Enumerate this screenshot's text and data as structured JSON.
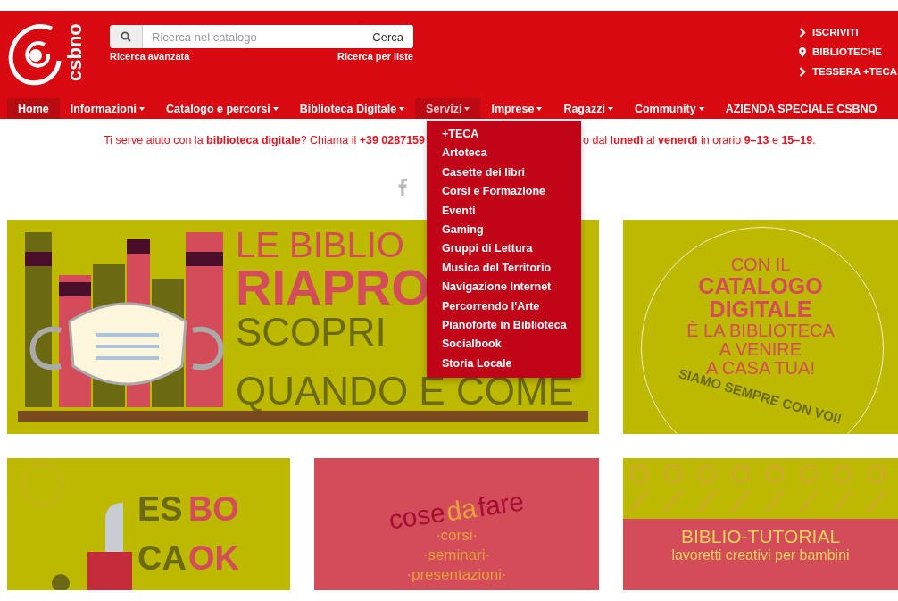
{
  "logo": {
    "text": "csbno"
  },
  "search": {
    "placeholder": "Ricerca nel catalogo",
    "button": "Cerca",
    "links": [
      "Ricerca avanzata",
      "Ricerca per liste"
    ]
  },
  "top_links": [
    {
      "label": "ISCRIVITI"
    },
    {
      "label": "BIBLIOTECHE"
    },
    {
      "label": "TESSERA +TECA"
    }
  ],
  "nav": [
    {
      "label": "Home",
      "selected": true,
      "has_menu": false,
      "expanded": false
    },
    {
      "label": "Informazioni",
      "selected": false,
      "has_menu": true,
      "expanded": false
    },
    {
      "label": "Catalogo e percorsi",
      "selected": false,
      "has_menu": true,
      "expanded": false
    },
    {
      "label": "Biblioteca Digitale",
      "selected": false,
      "has_menu": true,
      "expanded": false
    },
    {
      "label": "Servizi",
      "selected": false,
      "has_menu": true,
      "expanded": true
    },
    {
      "label": "Imprese",
      "selected": false,
      "has_menu": true,
      "expanded": false
    },
    {
      "label": "Ragazzi",
      "selected": false,
      "has_menu": true,
      "expanded": false
    },
    {
      "label": "Community",
      "selected": false,
      "has_menu": true,
      "expanded": false
    },
    {
      "label": "AZIENDA SPECIALE CSBNO",
      "selected": false,
      "has_menu": false,
      "expanded": false
    }
  ],
  "services_menu": {
    "items": [
      "+TECA",
      "Artoteca",
      "Casette dei libri",
      "Corsi e Formazione",
      "Eventi",
      "Gaming",
      "Gruppi di Lettura",
      "Musica del Territorio",
      "Navigazione Internet",
      "Percorrendo l'Arte",
      "Pianoforte in Biblioteca",
      "Socialbook",
      "Storia Locale"
    ]
  },
  "notice": {
    "before": "Ti serve aiuto con la **biblioteca digitale**? Chiama il **+39 0287159**",
    "after": "o dal **lunedì** al **venerdì** in orario **9–13** e **15–19**."
  },
  "banners": [
    {
      "kind": "books",
      "lines": [
        {
          "text": "LE BIBLIO",
          "accent": true
        },
        {
          "text": "RIAPRO",
          "accent": true
        },
        {
          "text": "SCOPRI",
          "accent": false
        },
        {
          "text": "QUANDO E COME",
          "accent": false
        }
      ]
    },
    {
      "kind": "catalog",
      "lines": [
        {
          "text": "CON IL",
          "accent": false
        },
        {
          "text": "CATALOGO",
          "accent": true
        },
        {
          "text": "DIGITALE",
          "accent": true
        },
        {
          "text": "È LA BIBLIOTECA",
          "accent": false
        },
        {
          "text": "A VENIRE",
          "accent": false
        },
        {
          "text": "A CASA TUA!",
          "accent": false
        }
      ],
      "slogan": "SIAMO SEMPRE CON VOI!"
    },
    {
      "kind": "escape",
      "lines": [
        {
          "text": "ES",
          "accent": false
        },
        {
          "text": "BO",
          "accent": true
        },
        {
          "text": "CA",
          "accent": false
        },
        {
          "text": "OK",
          "accent": true
        }
      ]
    },
    {
      "kind": "cose",
      "title": [
        {
          "text": "cose",
          "accent": false
        },
        {
          "text": "da",
          "accent": true
        },
        {
          "text": "fare",
          "accent": false
        }
      ],
      "lines": [
        {
          "text": "·corsi·"
        },
        {
          "text": "·seminari·"
        },
        {
          "text": "·presentazioni·"
        }
      ]
    },
    {
      "kind": "tutorial",
      "lines": [
        {
          "text": "BIBLIO-TUTORIAL"
        },
        {
          "text": "lavoretti creativi per bambini"
        }
      ]
    }
  ]
}
